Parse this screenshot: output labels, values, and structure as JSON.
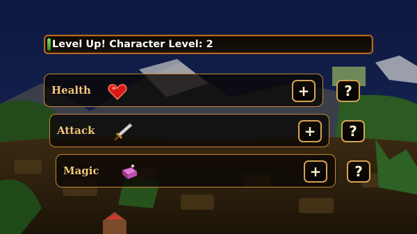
{
  "level_bar": {
    "text": "Level Up! Character Level: 2"
  },
  "stats": [
    {
      "label": "Health",
      "icon": "heart-icon",
      "plus": "+",
      "help": "?"
    },
    {
      "label": "Attack",
      "icon": "sword-icon",
      "plus": "+",
      "help": "?"
    },
    {
      "label": "Magic",
      "icon": "spellbook-icon",
      "plus": "+",
      "help": "?"
    }
  ],
  "colors": {
    "panel_border": "#c4883a",
    "label_text": "#f3c77b",
    "bar_border": "#b8681d",
    "bar_fill": "#2f8a25"
  }
}
